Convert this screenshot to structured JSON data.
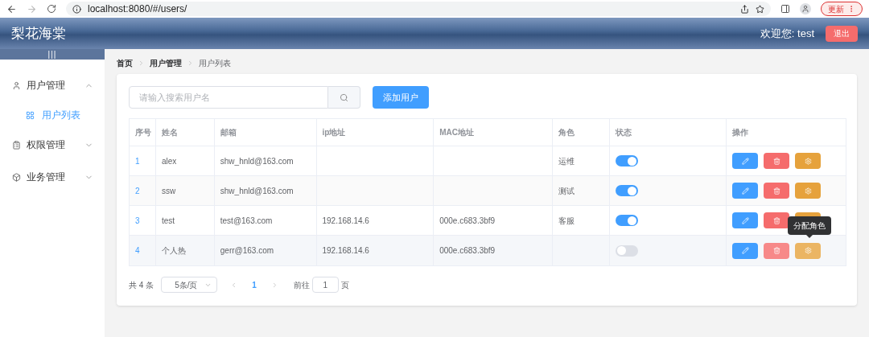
{
  "browser": {
    "url": "localhost:8080/#/users/",
    "update_button": "更新"
  },
  "header": {
    "title": "梨花海棠",
    "welcome": "欢迎您: test",
    "logout": "退出"
  },
  "sidebar": {
    "toggle": "|||",
    "items": [
      {
        "label": "用户管理",
        "expanded": true,
        "children": [
          {
            "label": "用户列表",
            "selected": true
          }
        ]
      },
      {
        "label": "权限管理",
        "expanded": false
      },
      {
        "label": "业务管理",
        "expanded": false
      }
    ]
  },
  "breadcrumb": [
    {
      "label": "首页",
      "current": false
    },
    {
      "label": "用户管理",
      "current": false
    },
    {
      "label": "用户列表",
      "current": true
    }
  ],
  "search": {
    "placeholder": "请输入搜索用户名"
  },
  "add_button": "添加用户",
  "table": {
    "columns": [
      "序号",
      "姓名",
      "邮箱",
      "ip地址",
      "MAC地址",
      "角色",
      "状态",
      "操作"
    ],
    "rows": [
      {
        "cells": [
          "1",
          "alex",
          "shw_hnld@163.com",
          "",
          "",
          "运维"
        ],
        "on": true,
        "hovered": false
      },
      {
        "cells": [
          "2",
          "ssw",
          "shw_hnld@163.com",
          "",
          "",
          "测试"
        ],
        "on": true,
        "hovered": false
      },
      {
        "cells": [
          "3",
          "test",
          "test@163.com",
          "192.168.14.6",
          "000e.c683.3bf9",
          "客服"
        ],
        "on": true,
        "hovered": false
      },
      {
        "cells": [
          "4",
          "个人热",
          "gerr@163.com",
          "192.168.14.6",
          "000e.c683.3bf9",
          ""
        ],
        "on": false,
        "hovered": true
      }
    ]
  },
  "tooltip": "分配角色",
  "pagination": {
    "total": "共 4 条",
    "page_size": "5条/页",
    "pages": [
      {
        "label": "1",
        "selected": true
      }
    ],
    "goto_label": "前往",
    "goto_value": "1",
    "goto_suffix": "页"
  }
}
